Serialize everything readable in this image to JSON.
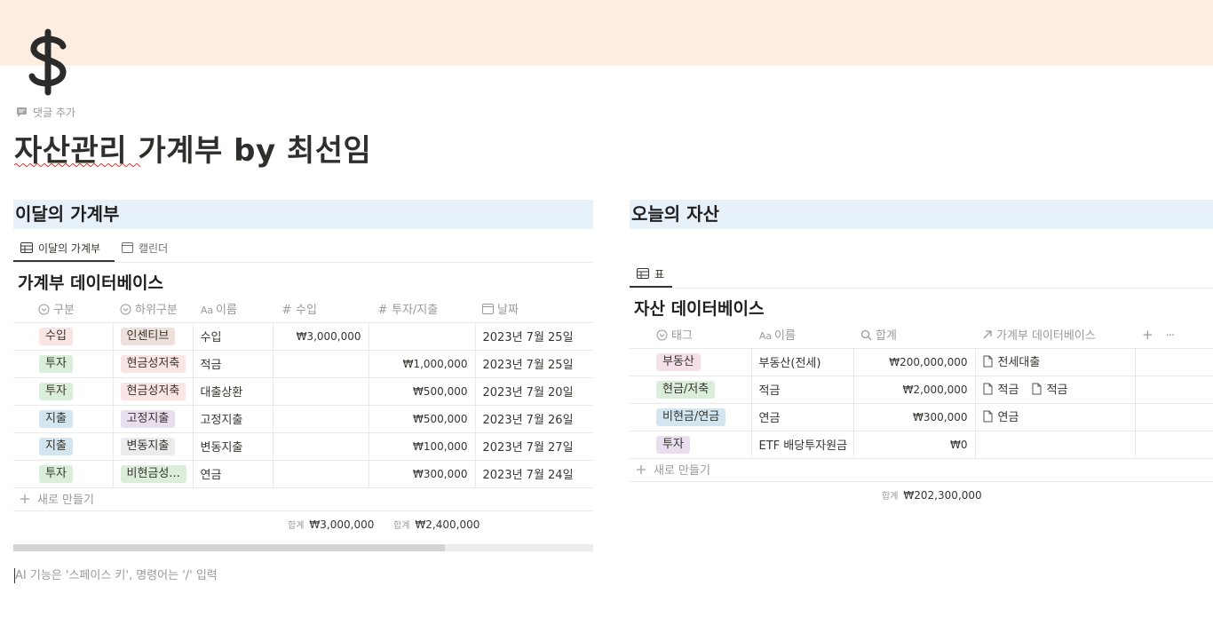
{
  "page": {
    "add_comment": "댓글 추가",
    "title": "자산관리 가계부 by 최선임",
    "icon": "dollar-icon",
    "ai_hint": "AI 기능은 '스페이스 키', 명령어는 '/' 입력"
  },
  "left": {
    "section_title": "이달의 가계부",
    "tabs": [
      {
        "label": "이달의 가계부",
        "icon": "table-icon"
      },
      {
        "label": "캘린더",
        "icon": "calendar-icon"
      }
    ],
    "db_title": "가계부 데이터베이스",
    "columns": [
      "구분",
      "하위구분",
      "이름",
      "수입",
      "투자/지출",
      "날짜"
    ],
    "column_icon_text": [
      "",
      "",
      "Aa",
      "#",
      "#",
      ""
    ],
    "rows": [
      {
        "category": "수입",
        "subcategory": "인센티브",
        "name": "수입",
        "income": "₩3,000,000",
        "expense": "",
        "date": "2023년 7월 25일"
      },
      {
        "category": "투자",
        "subcategory": "현금성저축",
        "name": "적금",
        "income": "",
        "expense": "₩1,000,000",
        "date": "2023년 7월 25일"
      },
      {
        "category": "투자",
        "subcategory": "현금성저축",
        "name": "대출상환",
        "income": "",
        "expense": "₩500,000",
        "date": "2023년 7월 20일"
      },
      {
        "category": "지출",
        "subcategory": "고정지출",
        "name": "고정지출",
        "income": "",
        "expense": "₩500,000",
        "date": "2023년 7월 26일"
      },
      {
        "category": "지출",
        "subcategory": "변동지출",
        "name": "변동지출",
        "income": "",
        "expense": "₩100,000",
        "date": "2023년 7월 27일"
      },
      {
        "category": "투자",
        "subcategory": "비현금성...",
        "name": "연금",
        "income": "",
        "expense": "₩300,000",
        "date": "2023년 7월 24일"
      }
    ],
    "new_row": "새로 만들기",
    "sum_label": "합계",
    "sum_income": "₩3,000,000",
    "sum_expense": "₩2,400,000"
  },
  "right": {
    "section_title": "오늘의 자산",
    "tabs": [
      {
        "label": "표",
        "icon": "table-icon"
      }
    ],
    "db_title": "자산 데이터베이스",
    "columns": [
      "태그",
      "이름",
      "합계",
      "가계부 데이터베이스"
    ],
    "column_icon_text": [
      "",
      "Aa",
      "",
      ""
    ],
    "add_column": "+",
    "more": "···",
    "rows": [
      {
        "tag": "부동산",
        "name": "부동산(전세)",
        "total": "₩200,000,000",
        "relations": [
          "전세대출"
        ]
      },
      {
        "tag": "현금/저축",
        "name": "적금",
        "total": "₩2,000,000",
        "relations": [
          "적금",
          "적금"
        ]
      },
      {
        "tag": "비현금/연금",
        "name": "연금",
        "total": "₩300,000",
        "relations": [
          "연금"
        ]
      },
      {
        "tag": "투자",
        "name": "ETF 배당투자원금",
        "total": "₩0",
        "relations": []
      }
    ],
    "new_row": "새로 만들기",
    "sum_label": "합계",
    "sum_total": "₩202,300,000"
  },
  "colors": {
    "cover": "#fdeee1",
    "section_header_bg": "#e7f1f9",
    "pill_red": "#fbe4e4",
    "pill_green": "#dbeddb",
    "pill_blue": "#d3e5ef",
    "pill_purple": "#e8deee",
    "pill_gray": "#ebeced",
    "pill_brown": "#eee0da",
    "pill_pink": "#f5e0e9"
  }
}
